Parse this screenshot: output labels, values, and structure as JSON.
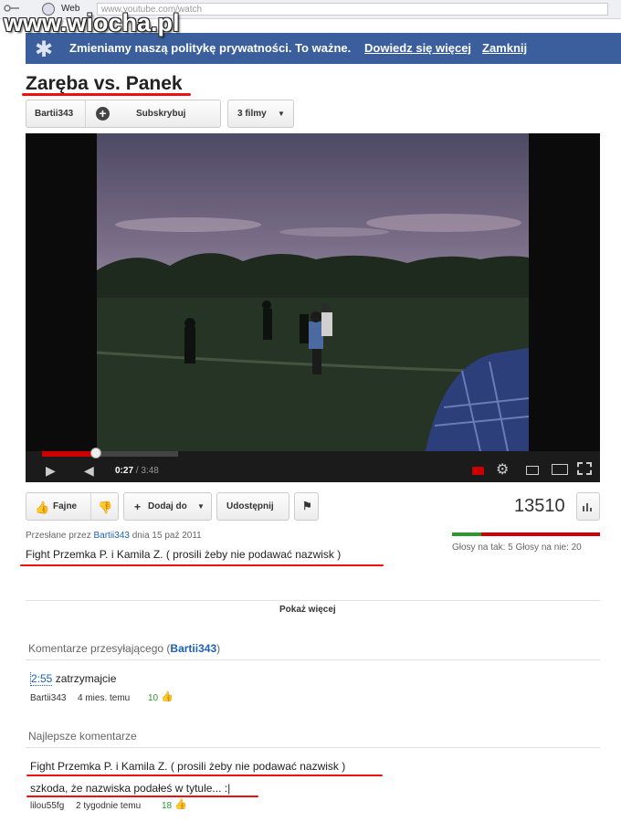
{
  "browser": {
    "tab_label": "Web",
    "url": "www.youtube.com/watch"
  },
  "watermark": "www.wiocha.pl",
  "banner": {
    "text": "Zmieniamy naszą politykę prywatności. To ważne.",
    "learn_more": "Dowiedz się więcej",
    "close": "Zamknij",
    "star_icon": "star-icon"
  },
  "video": {
    "title": "Zaręba vs. Panek",
    "channel": "Bartii343",
    "subscribe_label": "Subskrybuj",
    "videos_label": "3 filmy",
    "current_time": "0:27",
    "duration": "3:48",
    "progress_fraction": 0.118
  },
  "actions": {
    "like_label": "Fajne",
    "add_to_label": "Dodaj do",
    "share_label": "Udostępnij",
    "views": "13510"
  },
  "upload": {
    "prefix": "Przesłane przez",
    "user": "Bartii343",
    "date_text": "dnia 15 paź 2011",
    "description": "Fight Przemka P. i Kamila Z. ( prosili żeby nie podawać nazwisk )"
  },
  "votes": {
    "text": "Głosy na tak: 5 Głosy na nie: 20",
    "yes": 5,
    "no": 20
  },
  "show_more": "Pokaż więcej",
  "uploader_comments": {
    "heading_prefix": "Komentarze przesyłającego (",
    "heading_user": "Bartii343",
    "heading_suffix": ")",
    "comment": {
      "timestamp": "2:55",
      "text": " zatrzymajcie",
      "author": "Bartii343",
      "age": "4 mies. temu",
      "likes": "10"
    }
  },
  "top_comments": {
    "heading": "Najlepsze komentarze",
    "comment": {
      "line1": "Fight Przemka P. i Kamila Z. ( prosili żeby nie podawać nazwisk )",
      "line2": "szkoda, że nazwiska podałeś w tytule... :|",
      "author": "lilou55fg",
      "age": "2 tygodnie temu",
      "likes": "18"
    }
  },
  "colors": {
    "banner": "#3b5f9c",
    "progress": "#cc0000",
    "underline": "#e11111",
    "vote_yes": "#2a9b2a",
    "vote_no": "#cc0000"
  }
}
